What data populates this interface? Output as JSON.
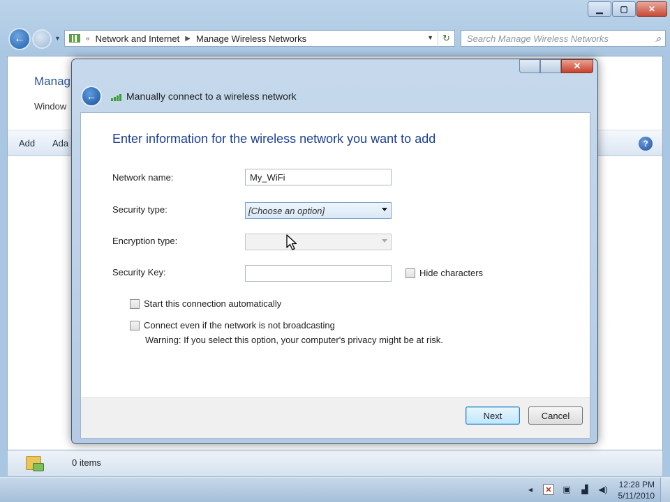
{
  "explorer": {
    "address": {
      "crumbs": [
        "Network and Internet",
        "Manage Wireless Networks"
      ]
    },
    "search_placeholder": "Search Manage Wireless Networks",
    "page_heading": "Manag",
    "page_sub": "Window",
    "toolbar": {
      "add_label": "Add",
      "adapter_label": "Ada"
    },
    "status": {
      "count_text": "0 items"
    }
  },
  "dialog": {
    "title": "Manually connect to a wireless network",
    "instruction": "Enter information for the wireless network you want to add",
    "fields": {
      "network_name_label": "Network name:",
      "network_name_value": "My_WiFi",
      "security_type_label": "Security type:",
      "security_type_value": "[Choose an option]",
      "encryption_type_label": "Encryption type:",
      "encryption_type_value": "",
      "security_key_label": "Security Key:",
      "security_key_value": ""
    },
    "checkboxes": {
      "hide_characters": "Hide characters",
      "start_automatically": "Start this connection automatically",
      "connect_not_broadcasting": "Connect even if the network is not broadcasting"
    },
    "warning": "Warning: If you select this option, your computer's privacy might be at risk.",
    "buttons": {
      "next": "Next",
      "cancel": "Cancel"
    }
  },
  "taskbar": {
    "time": "12:28 PM",
    "date": "5/11/2010"
  },
  "colors": {
    "instruction": "#1c3f94",
    "heading": "#2a5496",
    "close_button": "#c7402c"
  },
  "icons": {
    "back": "back-arrow-icon",
    "network": "wireless-signal-icon",
    "search": "magnifier-icon",
    "help": "help-icon"
  }
}
